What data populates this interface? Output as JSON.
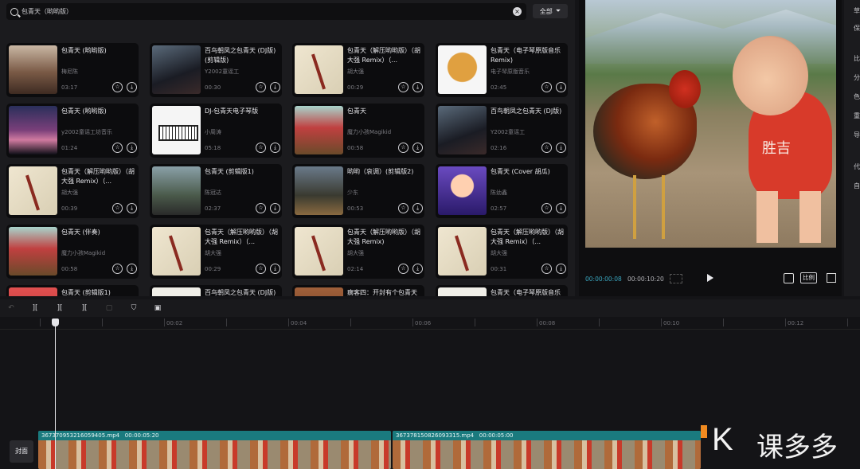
{
  "search": {
    "value": "包青天（哟哟版）",
    "clear_icon": "close-icon"
  },
  "filter": {
    "label": "全部",
    "icon": "filter-icon"
  },
  "cards": [
    {
      "title": "包青天 (哟哟版)",
      "artist": "梅尼陈",
      "duration": "03:17",
      "thumb": "th-portrait"
    },
    {
      "title": "百鸟朝凤之包青天 (DJ版) (剪辑版)",
      "artist": "Y2002童谣工",
      "duration": "00:30",
      "thumb": "th-dark-girl"
    },
    {
      "title": "包青天（解压哟哟版）（胡大强 Remix）（...",
      "artist": "胡大强",
      "duration": "00:29",
      "thumb": "th-cream"
    },
    {
      "title": "包青天（电子琴原版音乐 Remix)",
      "artist": "电子琴原版音乐",
      "duration": "02:45",
      "thumb": "th-mask"
    },
    {
      "title": "包青天 (哟哟版)",
      "artist": "y2002童谣工坊音乐",
      "duration": "01:24",
      "thumb": "th-sunset"
    },
    {
      "title": "DJ-包青天电子琴版",
      "artist": "小周涛",
      "duration": "05:18",
      "thumb": "th-keyboard"
    },
    {
      "title": "包青天",
      "artist": "魔力小孩Magikid",
      "duration": "00:58",
      "thumb": "th-magic"
    },
    {
      "title": "百鸟朝凤之包青天 (DJ版)",
      "artist": "Y2002童谣工",
      "duration": "02:16",
      "thumb": "th-dark-girl"
    },
    {
      "title": "包青天（解压哟哟版）（胡大强 Remix）（...",
      "artist": "胡大强",
      "duration": "00:39",
      "thumb": "th-cream"
    },
    {
      "title": "包青天 (剪辑版1)",
      "artist": "陈冠达",
      "duration": "02:37",
      "thumb": "th-man"
    },
    {
      "title": "哟哟（哀调）(剪辑版2)",
      "artist": "少东",
      "duration": "00:53",
      "thumb": "th-street"
    },
    {
      "title": "包青天 (Cover 胡瓜)",
      "artist": "陈幼鑫",
      "duration": "02:57",
      "thumb": "th-purple"
    },
    {
      "title": "包青天 (伴奏)",
      "artist": "魔力小孩Magikid",
      "duration": "00:58",
      "thumb": "th-magic"
    },
    {
      "title": "包青天（解压哟哟版）（胡大强 Remix）（...",
      "artist": "胡大强",
      "duration": "00:29",
      "thumb": "th-cream"
    },
    {
      "title": "包青天（解压哟哟版）（胡大强 Remix)",
      "artist": "胡大强",
      "duration": "02:14",
      "thumb": "th-cream"
    },
    {
      "title": "包青天（解压哟哟版）（胡大强 Remix）（...",
      "artist": "胡大强",
      "duration": "00:31",
      "thumb": "th-cream"
    },
    {
      "title": "包青天 (剪辑版1)",
      "artist": "",
      "duration": "",
      "thumb": "th-red"
    },
    {
      "title": "百鸟朝凤之包青天 (DJ版)",
      "artist": "",
      "duration": "",
      "thumb": "th-white"
    },
    {
      "title": "瘸客四：开封有个包青天",
      "artist": "",
      "duration": "",
      "thumb": "th-brown"
    },
    {
      "title": "包青天（电子琴原版音乐",
      "artist": "",
      "duration": "",
      "thumb": "th-white"
    }
  ],
  "preview": {
    "shirt_text": "胜吉",
    "current_time": "00:00:00:08",
    "total_time": "00:00:10:20",
    "ratio_label": "比例"
  },
  "right_panel": [
    "草",
    "保",
    "比",
    "分",
    "色",
    "重",
    "导",
    "代",
    "自"
  ],
  "ruler": [
    "00:02",
    "00:04",
    "00:06",
    "00:08",
    "00:10",
    "00:12"
  ],
  "cover_label": "封面",
  "clips": [
    {
      "name": "367370953216059405.mp4",
      "duration": "00:00:05:20"
    },
    {
      "name": "367378150826093315.mp4",
      "duration": "00:00:05:00"
    }
  ],
  "watermark": {
    "letter": "K",
    "text": "课多多"
  }
}
